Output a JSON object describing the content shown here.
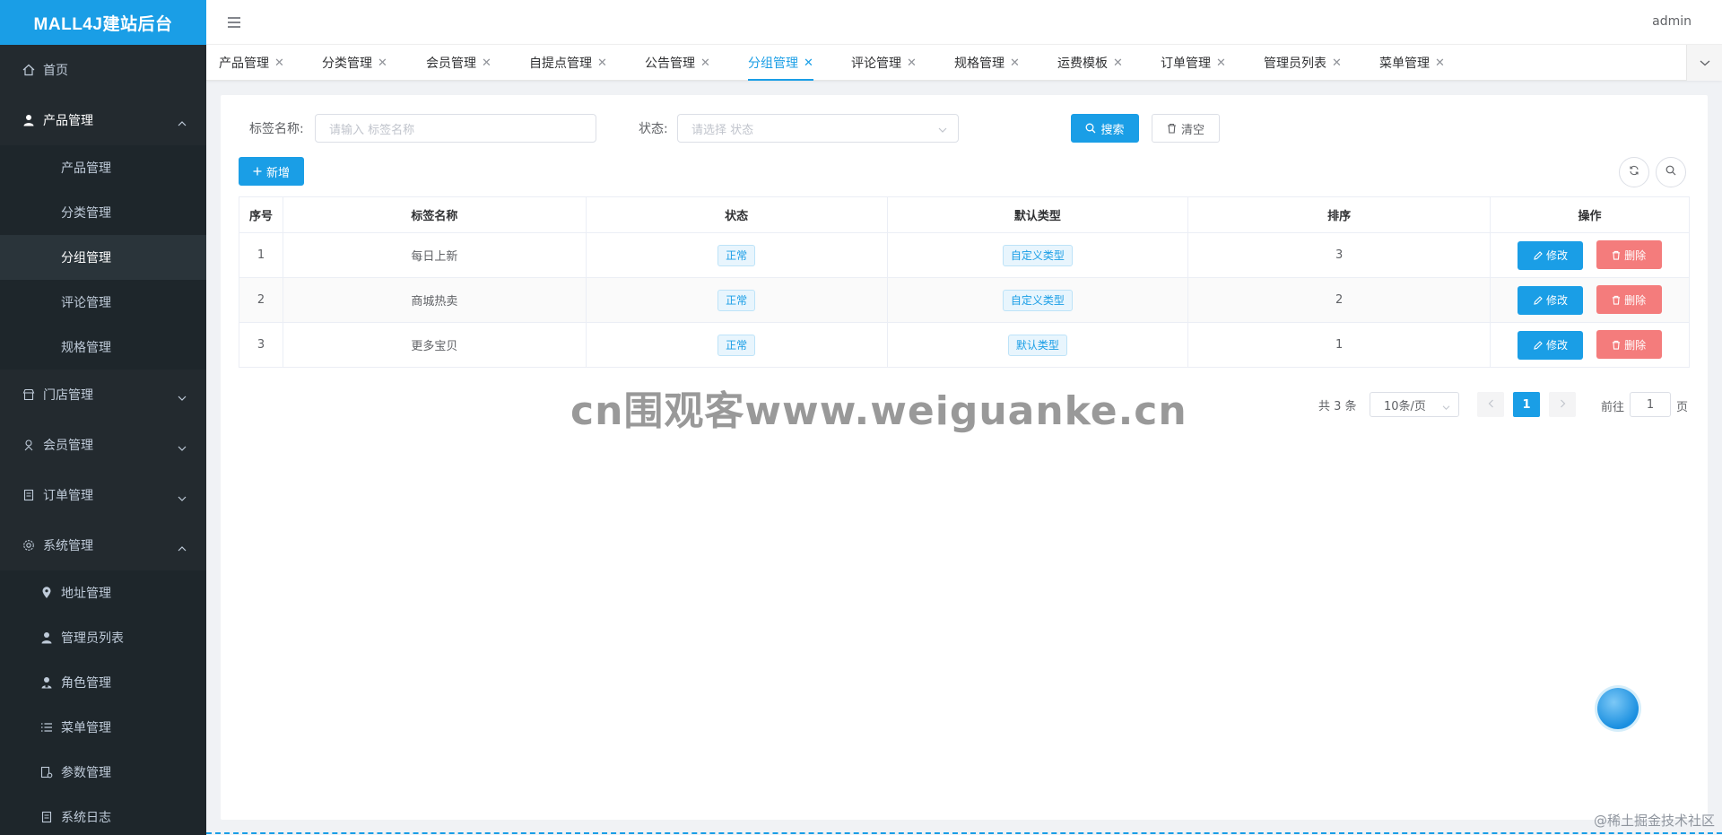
{
  "app": {
    "title": "MALL4J建站后台"
  },
  "header": {
    "user": "admin"
  },
  "sidebar": {
    "items": [
      {
        "label": "首页",
        "icon": "home-icon"
      },
      {
        "label": "产品管理",
        "icon": "user-icon",
        "open": true,
        "children": [
          "产品管理",
          "分类管理",
          "分组管理",
          "评论管理",
          "规格管理"
        ],
        "active_child": "分组管理"
      },
      {
        "label": "门店管理",
        "icon": "shop-icon"
      },
      {
        "label": "会员管理",
        "icon": "member-icon"
      },
      {
        "label": "订单管理",
        "icon": "order-icon"
      },
      {
        "label": "系统管理",
        "icon": "gear-icon",
        "open": true,
        "children": [
          "地址管理",
          "管理员列表",
          "角色管理",
          "菜单管理",
          "参数管理",
          "系统日志"
        ]
      }
    ]
  },
  "tabs": [
    "产品管理",
    "分类管理",
    "会员管理",
    "自提点管理",
    "公告管理",
    "分组管理",
    "评论管理",
    "规格管理",
    "运费模板",
    "订单管理",
    "管理员列表",
    "菜单管理"
  ],
  "active_tab": "分组管理",
  "search": {
    "name_label": "标签名称:",
    "name_placeholder": "请输入 标签名称",
    "status_label": "状态:",
    "status_placeholder": "请选择 状态",
    "search_button": "搜索",
    "clear_button": "清空"
  },
  "toolbar": {
    "add_button": "新增"
  },
  "table": {
    "headers": [
      "序号",
      "标签名称",
      "状态",
      "默认类型",
      "排序",
      "操作"
    ],
    "rows": [
      {
        "index": "1",
        "name": "每日上新",
        "status": "正常",
        "type": "自定义类型",
        "sort": "3"
      },
      {
        "index": "2",
        "name": "商城热卖",
        "status": "正常",
        "type": "自定义类型",
        "sort": "2"
      },
      {
        "index": "3",
        "name": "更多宝贝",
        "status": "正常",
        "type": "默认类型",
        "sort": "1"
      }
    ],
    "edit_label": "修改",
    "delete_label": "删除"
  },
  "pagination": {
    "total": "共 3 条",
    "page_size": "10条/页",
    "current_page": "1",
    "goto_prefix": "前往",
    "goto_value": "1",
    "goto_suffix": "页"
  },
  "watermark": "cn围观客www.weiguanke.cn",
  "corner_mark": "@稀土掘金技术社区",
  "colors": {
    "primary": "#1a9ee6",
    "sidebar": "#232a2f",
    "danger": "#f47c7c"
  }
}
